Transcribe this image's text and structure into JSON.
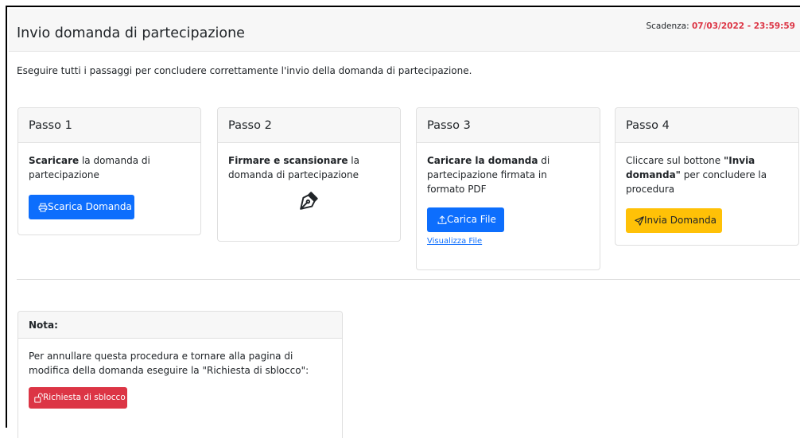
{
  "header": {
    "title": "Invio domanda di partecipazione",
    "deadline_label": "Scadenza:",
    "deadline_value": "07/03/2022 - 23:59:59"
  },
  "intro": "Eseguire tutti i passaggi per concludere correttamente l'invio della domanda di partecipazione.",
  "steps": [
    {
      "title": "Passo 1",
      "bold": "Scaricare",
      "text": " la domanda di partecipazione",
      "button": "Scarica Domanda",
      "icon": "printer-icon"
    },
    {
      "title": "Passo 2",
      "bold": "Firmare e scansionare",
      "text": " la domanda di partecipazione",
      "icon": "pen-nib-icon"
    },
    {
      "title": "Passo 3",
      "bold": "Caricare la domanda",
      "text": " di partecipazione firmata in formato PDF",
      "button": "Carica File",
      "link": "Visualizza File",
      "icon": "upload-icon"
    },
    {
      "title": "Passo 4",
      "text_before": "Cliccare sul bottone ",
      "bold": "\"Invia domanda\"",
      "text": " per concludere la procedura",
      "button": "Invia Domanda",
      "icon": "send-icon"
    }
  ],
  "note": {
    "title": "Nota:",
    "text": "Per annullare questa procedura e tornare alla pagina di modifica della domanda eseguire la \"Richiesta di sblocco\":",
    "button": "Richiesta di sblocco",
    "icon": "unlock-icon"
  },
  "colors": {
    "primary": "#0d6efd",
    "warning": "#ffc107",
    "danger": "#dc3545"
  }
}
